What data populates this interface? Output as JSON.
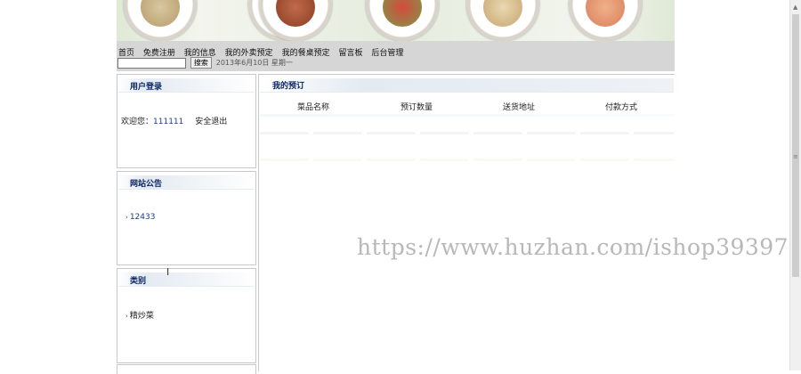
{
  "nav": {
    "links": [
      "首页",
      "免费注册",
      "我的信息",
      "我的外卖预定",
      "我的餐桌预定",
      "留言板",
      "后台管理"
    ],
    "search_placeholder": "",
    "search_button": "搜索",
    "date": "2013年6月10日 星期一"
  },
  "login_box": {
    "title": "用户登录",
    "welcome": "欢迎您：",
    "username": "111111",
    "logout": "安全退出"
  },
  "notice_box": {
    "title": "网站公告",
    "items": [
      "12433"
    ]
  },
  "category_box": {
    "title": "类别",
    "items": [
      "精炒菜"
    ]
  },
  "orders": {
    "title": "我的预订",
    "columns": [
      "菜品名称",
      "预订数量",
      "送货地址",
      "付款方式"
    ]
  },
  "watermark": "https://www.huzhan.com/ishop39397",
  "colors": {
    "nav_bg": "#d6d6d6",
    "box_title": "#0a2460",
    "border": "#c8c8c8"
  }
}
